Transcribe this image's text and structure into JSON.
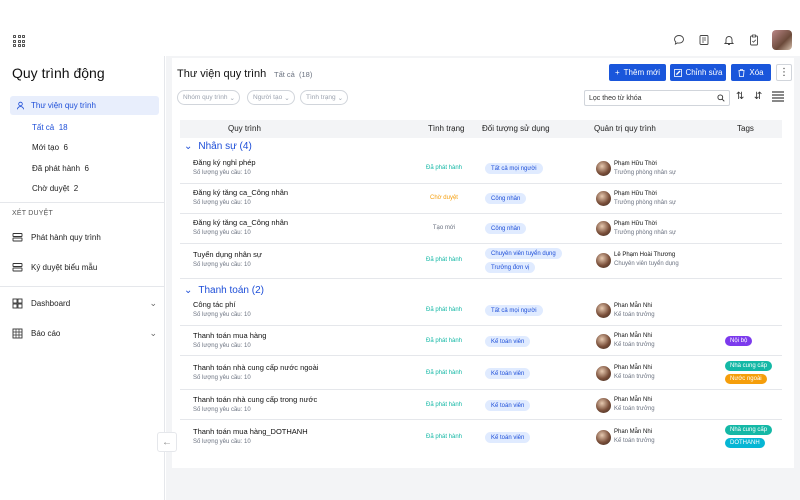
{
  "header": {
    "icons": [
      "chat-icon",
      "notes-icon",
      "bell-icon",
      "clipboard-icon",
      "avatar"
    ]
  },
  "sidebar": {
    "title": "Quy trình động",
    "active_item": "Thư viện quy trình",
    "sub_items": [
      {
        "label": "Tất cả",
        "count": "18",
        "active": true
      },
      {
        "label": "Mới tạo",
        "count": "6"
      },
      {
        "label": "Đã phát hành",
        "count": "6"
      },
      {
        "label": "Chờ duyệt",
        "count": "2"
      }
    ],
    "section_label": "XÉT DUYỆT",
    "review_items": [
      "Phát hành quy trình",
      "Ký duyệt biểu mẫu"
    ],
    "nav_items": [
      "Dashboard",
      "Báo cáo"
    ],
    "collapse_icon": "←"
  },
  "toolbar": {
    "title": "Thư viện quy trình",
    "count_label": "Tất cả",
    "count": "(18)",
    "add_label": "Thêm mới",
    "edit_label": "Chỉnh sửa",
    "delete_label": "Xóa",
    "more_label": "⋮"
  },
  "filters": [
    "Nhóm quy trình",
    "Người tạo",
    "Tình trạng"
  ],
  "search": {
    "placeholder": "Lọc theo từ khóa"
  },
  "table": {
    "headers": [
      "Quy trình",
      "Tình trạng",
      "Đối tượng sử dụng",
      "Quản trị quy trình",
      "Tags"
    ],
    "groups": [
      {
        "label": "Nhân sự (4)"
      },
      {
        "label": "Thanh toán (2)"
      }
    ],
    "rows": [
      {
        "name": "Đăng ký nghỉ phép",
        "sub": "Số lượng yêu cầu: 10",
        "status": "Đã phát hành",
        "users": [
          "Tất cả mọi người"
        ],
        "manager": "Phạm Hữu Thời",
        "role": "Trưởng phòng nhân sự",
        "tags": []
      },
      {
        "name": "Đăng ký tăng ca_Công nhân",
        "sub": "Số lượng yêu cầu: 10",
        "status": "Chờ duyệt",
        "users": [
          "Công nhân"
        ],
        "manager": "Phạm Hữu Thời",
        "role": "Trưởng phòng nhân sự",
        "tags": []
      },
      {
        "name": "Đăng ký tăng ca_Công nhân",
        "sub": "Số lượng yêu cầu: 10",
        "status": "Tạo mới",
        "users": [
          "Công nhân"
        ],
        "manager": "Phạm Hữu Thời",
        "role": "Trưởng phòng nhân sự",
        "tags": []
      },
      {
        "name": "Tuyển dụng nhân sự",
        "sub": "Số lượng yêu cầu: 10",
        "status": "Đã phát hành",
        "users": [
          "Chuyên viên tuyển dụng",
          "Trưởng đơn vị"
        ],
        "manager": "Lê Phạm Hoài Thương",
        "role": "Chuyên viên tuyển dụng",
        "tags": []
      },
      {
        "name": "Công tác phí",
        "sub": "Số lượng yêu cầu: 10",
        "status": "Đã phát hành",
        "users": [
          "Tất cả mọi người"
        ],
        "manager": "Phan Mẫn Nhi",
        "role": "Kế toán trưởng",
        "tags": []
      },
      {
        "name": "Thanh toán mua hàng",
        "sub": "Số lượng yêu cầu: 10",
        "status": "Đã phát hành",
        "users": [
          "Kế toán viên"
        ],
        "manager": "Phan Mẫn Nhi",
        "role": "Kế toán trưởng",
        "tags": [
          "Nội bộ"
        ]
      },
      {
        "name": "Thanh toán nhà cung cấp nước ngoài",
        "sub": "Số lượng yêu cầu: 10",
        "status": "Đã phát hành",
        "users": [
          "Kế toán viên"
        ],
        "manager": "Phan Mẫn Nhi",
        "role": "Kế toán trưởng",
        "tags": [
          "Nhà cung cấp",
          "Nước ngoài"
        ]
      },
      {
        "name": "Thanh toán nhà cung cấp trong nước",
        "sub": "Số lượng yêu cầu: 10",
        "status": "Đã phát hành",
        "users": [
          "Kế toán viên"
        ],
        "manager": "Phan Mẫn Nhi",
        "role": "Kế toán trưởng",
        "tags": []
      },
      {
        "name": "Thanh toán mua hàng_DOTHANH",
        "sub": "Số lượng yêu cầu: 10",
        "status": "Đã phát hành",
        "users": [
          "Kế toán viên"
        ],
        "manager": "Phan Mẫn Nhi",
        "role": "Kế toán trưởng",
        "tags": [
          "Nhà cung cấp",
          "DOTHANH"
        ]
      }
    ]
  },
  "colors": {
    "primary": "#1a56db",
    "status_published": "#14b8a6",
    "status_pending": "#f59e0b",
    "status_new": "#6b7280",
    "tag_internal": "#7c3aed",
    "tag_supplier": "#14b8a6",
    "tag_foreign": "#f59e0b",
    "tag_dothanh": "#06b6d4"
  }
}
